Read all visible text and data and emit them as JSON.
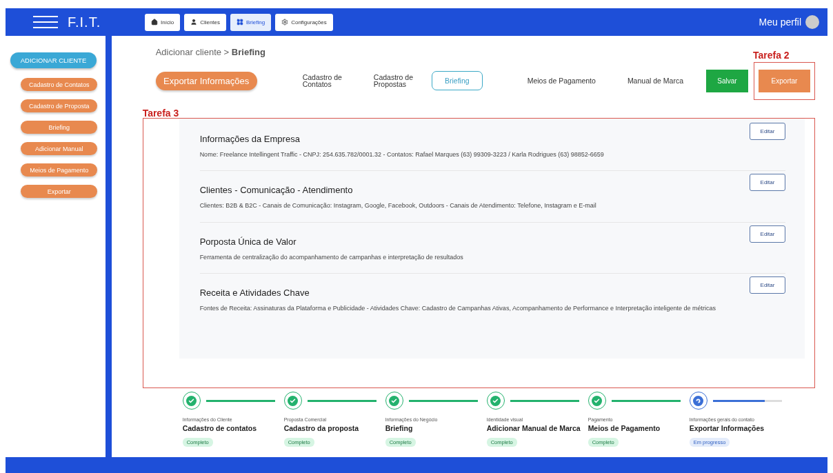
{
  "header": {
    "logo": "F.I.T.",
    "nav": [
      {
        "label": "Início",
        "selected": false
      },
      {
        "label": "Clientes",
        "selected": false
      },
      {
        "label": "Briefing",
        "selected": true
      },
      {
        "label": "Configurações",
        "selected": false
      }
    ],
    "profile": "Meu perfil"
  },
  "sidebar": {
    "main_button": "ADICIONAR CLIENTE",
    "items": [
      "Cadastro de Contatos",
      "Cadastro de Proposta",
      "Briefing",
      "Adicionar Manual",
      "Meios de Pagamento",
      "Exportar"
    ]
  },
  "breadcrumb": {
    "parent": "Adicionar cliente >",
    "current": "Briefing"
  },
  "toolbar": {
    "primary_button": "Exportar Informações",
    "tabs": [
      {
        "label": "Cadastro de\nContatos",
        "selected": false
      },
      {
        "label": "Cadastro de\nPropostas",
        "selected": false
      },
      {
        "label": "Briefing",
        "selected": true
      },
      {
        "label": "Meios de Pagamento",
        "selected": false
      },
      {
        "label": "Manual de Marca",
        "selected": false
      }
    ],
    "save_button": "Salvar",
    "export_button": "Exportar",
    "export_annotation": "Tarefa 2"
  },
  "panel_annotation": "Tarefa 3",
  "sections": [
    {
      "title": "Informações da Empresa",
      "text": "Nome: Freelance Intellingent Traffic - CNPJ: 254.635.782/0001.32 - Contatos: Rafael Marques (63) 99309-3223 / Karla Rodrigues (63) 98852-6659",
      "button": "Editar"
    },
    {
      "title": "Clientes - Comunicação - Atendimento",
      "text": "Clientes: B2B & B2C - Canais de Comunicação: Instagram, Google, Facebook, Outdoors - Canais de Atendimento: Telefone, Instagram e E-mail",
      "button": "Editar"
    },
    {
      "title": "Porposta Única de Valor",
      "text": "Ferramenta de centralização do acompanhamento de campanhas e interpretação de resultados",
      "button": "Editar"
    },
    {
      "title": "Receita e Atividades Chave",
      "text": "Fontes de Receita: Assinaturas da Plataforma e Publicidade - Atividades Chave: Cadastro de Campanhas Ativas, Acompanhamento de Performance e Interpretação inteligente de métricas",
      "button": "Editar"
    }
  ],
  "steps": [
    {
      "caption": "Informações do Cliente",
      "title": "Cadastro de contatos",
      "kind": "complete",
      "tag": "Completo",
      "level": 1
    },
    {
      "caption": "Proposta Comercial",
      "title": "Cadastro da proposta",
      "kind": "complete",
      "tag": "Completo",
      "level": 1
    },
    {
      "caption": "Informações do Negócio",
      "title": "Briefing",
      "kind": "complete",
      "tag": "Completo",
      "level": 1
    },
    {
      "caption": "Identidade visual",
      "title": "Adicionar Manual de Marca",
      "kind": "complete",
      "tag": "Completo",
      "level": 1
    },
    {
      "caption": "Pagamento",
      "title": "Meios de Pagamento",
      "kind": "complete",
      "tag": "Completo",
      "level": 1
    },
    {
      "caption": "Informações gerais do contato",
      "title": "Exportar Informações",
      "kind": "in_progress",
      "tag": "Em progresso",
      "level": 0.75
    }
  ]
}
